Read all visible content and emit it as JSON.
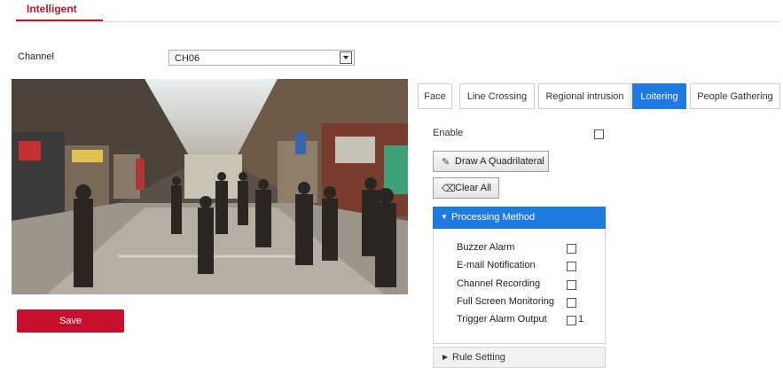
{
  "header": {
    "tab_label": "Intelligent"
  },
  "channel": {
    "label": "Channel",
    "value": "CH06"
  },
  "preview": {
    "description_icon": "camera-feed"
  },
  "save_label": "Save",
  "tabs": [
    {
      "label": "Face",
      "active": false
    },
    {
      "label": "Line Crossing",
      "active": false
    },
    {
      "label": "Regional intrusion",
      "active": false
    },
    {
      "label": "Loitering",
      "active": true
    },
    {
      "label": "People Gathering",
      "active": false
    }
  ],
  "enable": {
    "label": "Enable",
    "checked": false
  },
  "buttons": {
    "draw_label": "Draw A Quadrilateral",
    "draw_icon": "pencil-icon",
    "clear_label": "Clear All",
    "clear_icon": "eraser-icon"
  },
  "processing": {
    "title": "Processing Method",
    "items": [
      {
        "label": "Buzzer Alarm",
        "checked": false
      },
      {
        "label": "E-mail Notification",
        "checked": false
      },
      {
        "label": "Channel Recording",
        "checked": false
      },
      {
        "label": "Full Screen Monitoring",
        "checked": false
      },
      {
        "label": "Trigger Alarm Output",
        "checked": false,
        "suffix": "1"
      }
    ]
  },
  "rule_setting": {
    "title": "Rule Setting"
  },
  "colors": {
    "accent_red": "#c8102e",
    "accent_blue": "#1f7be0"
  }
}
